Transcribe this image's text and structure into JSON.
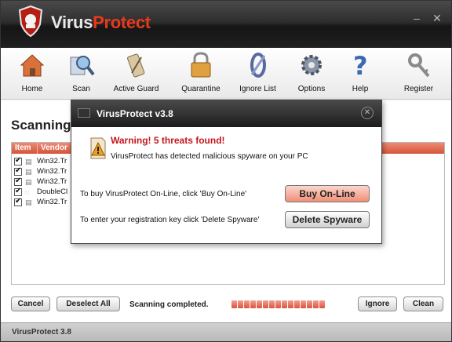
{
  "app": {
    "title_part1": "Virus",
    "title_part2": "Protect",
    "window_buttons": [
      "–",
      "✕"
    ]
  },
  "toolbar": {
    "items": [
      {
        "label": "Home",
        "icon": "home-icon"
      },
      {
        "label": "Scan",
        "icon": "magnifier-icon"
      },
      {
        "label": "Active Guard",
        "icon": "guard-icon"
      },
      {
        "label": "Quarantine",
        "icon": "padlock-icon"
      },
      {
        "label": "Ignore List",
        "icon": "ignore-icon"
      },
      {
        "label": "Options",
        "icon": "gear-icon"
      },
      {
        "label": "Help",
        "icon": "help-icon"
      },
      {
        "label": "Register",
        "icon": "key-icon"
      }
    ]
  },
  "main": {
    "title": "Scanning",
    "columns": [
      "Item",
      "Vendor"
    ],
    "rows": [
      {
        "name": "Win32.Tr",
        "icon": "file-icon"
      },
      {
        "name": "Win32.Tr",
        "icon": "file-icon"
      },
      {
        "name": "Win32.Tr",
        "icon": "file-icon"
      },
      {
        "name": "DoubleCl",
        "icon": "cookie-icon"
      },
      {
        "name": "Win32.Tr",
        "icon": "file-icon"
      }
    ],
    "cancel_label": "Cancel",
    "deselect_label": "Deselect All",
    "status": "Scanning completed.",
    "progress": 1.0,
    "ignore_label": "Ignore",
    "clean_label": "Clean"
  },
  "statusbar": {
    "text": "VirusProtect 3.8"
  },
  "dialog": {
    "title": "VirusProtect v3.8",
    "close": "✕",
    "warning": "Warning! 5 threats found!",
    "message": "VirusProtect  has detected malicious spyware on your PC",
    "buy_text": "To buy VirusProtect On-Line, click 'Buy On-Line'",
    "buy_label": "Buy On-Line",
    "register_text": "To enter your registration key click 'Delete Spyware'",
    "delete_label": "Delete Spyware"
  },
  "colors": {
    "accent": "#e8391c",
    "warning": "#c4161c"
  }
}
